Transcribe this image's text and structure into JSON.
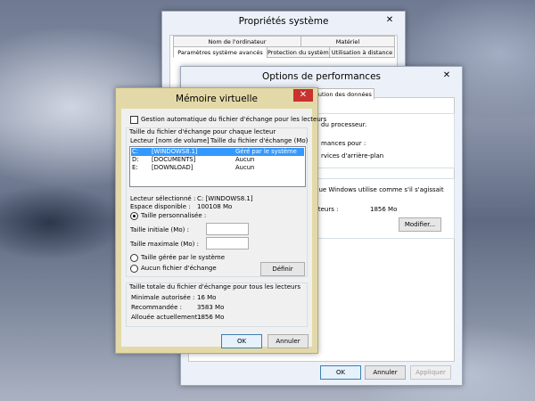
{
  "colors": {
    "selection": "#3399ff",
    "close_button": "#c7312e",
    "mv_frame": "#e3d9a8"
  },
  "props": {
    "title": "Propriétés système",
    "tabs": {
      "computer_name": "Nom de l'ordinateur",
      "hardware": "Matériel",
      "advanced": "Paramètres système avancés",
      "protection": "Protection du système",
      "remote": "Utilisation à distance"
    }
  },
  "perf": {
    "title": "Options de performances",
    "tab_dep": "...cution des données",
    "text1": "du processeur.",
    "text2": "mances pour :",
    "text3": "rvices d'arrière-plan",
    "text4": "que Windows utilise comme s'il s'agissait",
    "text5": "cteurs :",
    "size_value": "1856 Mo",
    "modify_label": "Modifier...",
    "ok_label": "OK",
    "cancel_label": "Annuler",
    "apply_label": "Appliquer"
  },
  "mv": {
    "title": "Mémoire virtuelle",
    "auto_label": "Gestion automatique du fichier d'échange pour les lecteurs",
    "group1_title": "Taille du fichier d'échange pour chaque lecteur",
    "col_drive": "Lecteur [nom de volume]",
    "col_size": "Taille du fichier d'échange (Mo)",
    "drives": [
      {
        "letter": "C:",
        "name": "[WINDOWS8.1]",
        "size": "Géré par le système"
      },
      {
        "letter": "D:",
        "name": "[DOCUMENTS]",
        "size": "Aucun"
      },
      {
        "letter": "E:",
        "name": "[DOWNLOAD]",
        "size": "Aucun"
      }
    ],
    "selected_label": "Lecteur sélectionné :",
    "selected_value": "C:  [WINDOWS8.1]",
    "space_label": "Espace disponible :",
    "space_value": "100108 Mo",
    "custom_label": "Taille personnalisée :",
    "initial_label": "Taille initiale (Mo) :",
    "max_label": "Taille maximale (Mo) :",
    "system_label": "Taille gérée par le système",
    "none_label": "Aucun fichier d'échange",
    "set_label": "Définir",
    "group2_title": "Taille totale du fichier d'échange pour tous les lecteurs",
    "min_label": "Minimale autorisée :",
    "min_value": "16 Mo",
    "rec_label": "Recommandée :",
    "rec_value": "3583 Mo",
    "alloc_label": "Allouée actuellement :",
    "alloc_value": "1856 Mo",
    "ok_label": "OK",
    "cancel_label": "Annuler"
  }
}
